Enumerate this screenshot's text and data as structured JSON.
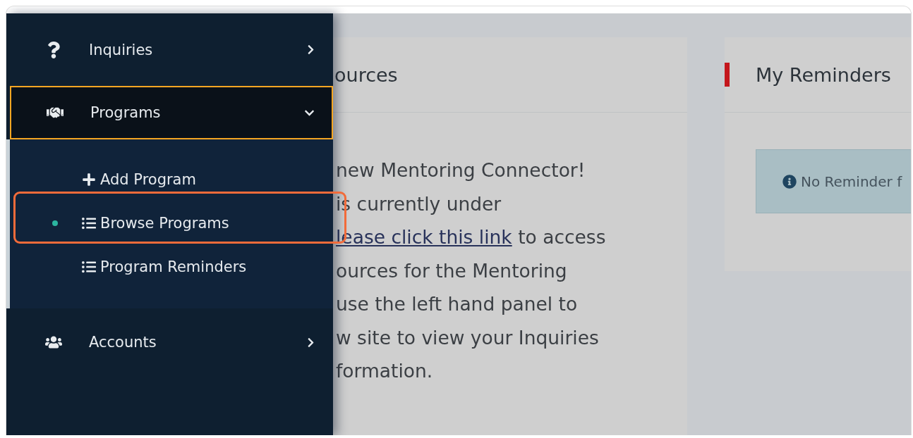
{
  "sidebar": {
    "items": [
      {
        "label": "Inquiries",
        "selected": false,
        "expanded": false
      },
      {
        "label": "Programs",
        "selected": true,
        "expanded": true,
        "children": [
          {
            "label": "Add Program",
            "kind": "add",
            "selected": false
          },
          {
            "label": "Browse Programs",
            "kind": "list",
            "selected": true
          },
          {
            "label": "Program Reminders",
            "kind": "list",
            "selected": false
          }
        ]
      },
      {
        "label": "Accounts",
        "selected": false,
        "expanded": false
      }
    ]
  },
  "resources_card": {
    "title": "ources",
    "lines": [
      {
        "text": "new Mentoring Connector!"
      },
      {
        "text": "is currently under"
      },
      {
        "link": "lease click this link",
        "text": " to access"
      },
      {
        "text": "ources for the Mentoring"
      },
      {
        "text": "use the left hand panel to"
      },
      {
        "text": "w site to view your Inquiries"
      },
      {
        "text": "formation."
      }
    ]
  },
  "reminders_card": {
    "title": "My Reminders",
    "alert": "No Reminder f"
  }
}
